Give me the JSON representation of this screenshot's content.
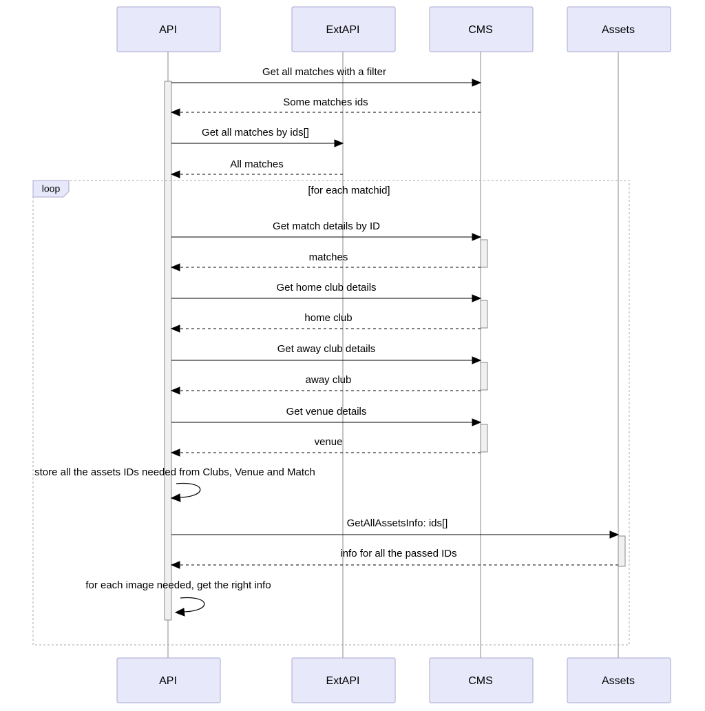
{
  "participants": {
    "api": "API",
    "extapi": "ExtAPI",
    "cms": "CMS",
    "assets": "Assets"
  },
  "loop": {
    "label": "loop",
    "condition": "[for each matchid]"
  },
  "messages": {
    "m1": "Get all matches with a filter",
    "m2": "Some matches ids",
    "m3": "Get all matches by ids[]",
    "m4": "All matches",
    "m5": "Get match details by ID",
    "m6": "matches",
    "m7": "Get home club details",
    "m8": "home club",
    "m9": "Get away club details",
    "m10": "away club",
    "m11": "Get venue details",
    "m12": "venue",
    "m13": "store all the assets IDs needed from Clubs, Venue and Match",
    "m14": "GetAllAssetsInfo: ids[]",
    "m15": "info for all the passed IDs",
    "m16": "for each image needed, get the right info"
  }
}
